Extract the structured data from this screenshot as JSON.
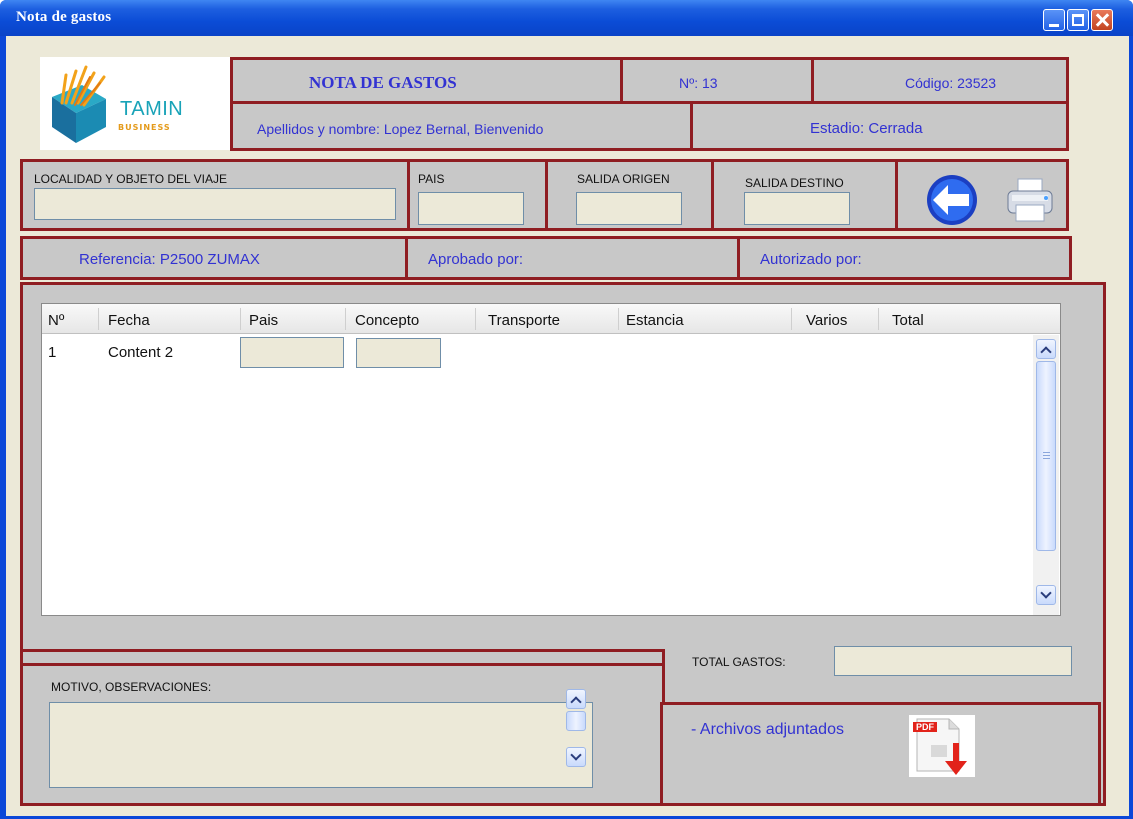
{
  "window": {
    "title": "Nota de gastos"
  },
  "header": {
    "logo_text": "TAMIN",
    "logo_sub": "BUSINESS",
    "doc_title": "NOTA DE GASTOS",
    "number": "Nº: 13",
    "code": "Código:  23523",
    "name": "Apellidos y nombre: Lopez Bernal, Bienvenido",
    "status": "Estadio: Cerrada"
  },
  "trip": {
    "locality_label": "LOCALIDAD Y OBJETO DEL VIAJE",
    "country_label": "PAIS",
    "origin_label": "SALIDA ORIGEN",
    "destination_label": "SALIDA DESTINO"
  },
  "refs": {
    "reference": "Referencia: P2500 ZUMAX",
    "approved": "Aprobado por:",
    "authorized": "Autorizado por:"
  },
  "table": {
    "columns": [
      "Nº",
      "Fecha",
      "Pais",
      "Concepto",
      "Transporte",
      "Estancia",
      "Varios",
      "Total"
    ],
    "rows": [
      {
        "n": "1",
        "fecha": "Content 2"
      }
    ]
  },
  "totals": {
    "label": "TOTAL GASTOS:"
  },
  "notes": {
    "label": "MOTIVO, OBSERVACIONES:"
  },
  "attachments": {
    "label": "- Archivos adjuntados",
    "pdf_badge": "PDF"
  },
  "colors": {
    "border": "#8f1d22",
    "panel": "#c8c8c8",
    "text_blue": "#3232d2"
  }
}
